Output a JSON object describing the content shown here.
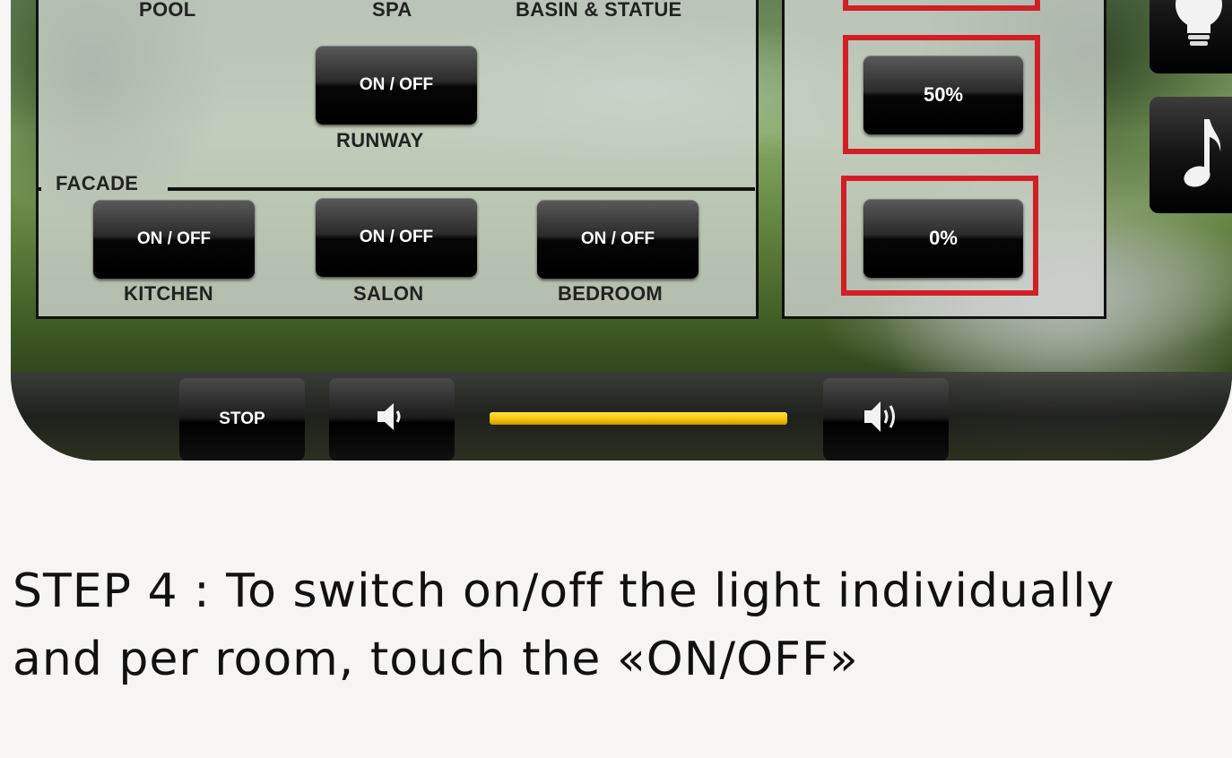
{
  "zones": {
    "pool_label": "POOL",
    "spa_label": "SPA",
    "basin_label": "BASIN & STATUE",
    "facade_label": "FACADE"
  },
  "light_buttons": {
    "runway_button": "ON / OFF",
    "runway_label": "RUNWAY",
    "kitchen_button": "ON / OFF",
    "kitchen_label": "KITCHEN",
    "salon_button": "ON / OFF",
    "salon_label": "SALON",
    "bedroom_button": "ON / OFF",
    "bedroom_label": "BEDROOM"
  },
  "dimmer": {
    "level_50": "50%",
    "level_0": "0%",
    "highlight_color": "#d11f25"
  },
  "side_menu": {
    "icons": [
      "lightbulb-icon",
      "music-note-icon"
    ]
  },
  "audio": {
    "stop_label": "STOP",
    "volume_fraction": 1.0,
    "volume_color": "#f2c200",
    "icons": [
      "volume-down-icon",
      "volume-up-icon"
    ]
  },
  "caption": {
    "line1": "STEP 4 : To switch on/off the light individually",
    "line2": "and per room, touch the «ON/OFF»"
  }
}
